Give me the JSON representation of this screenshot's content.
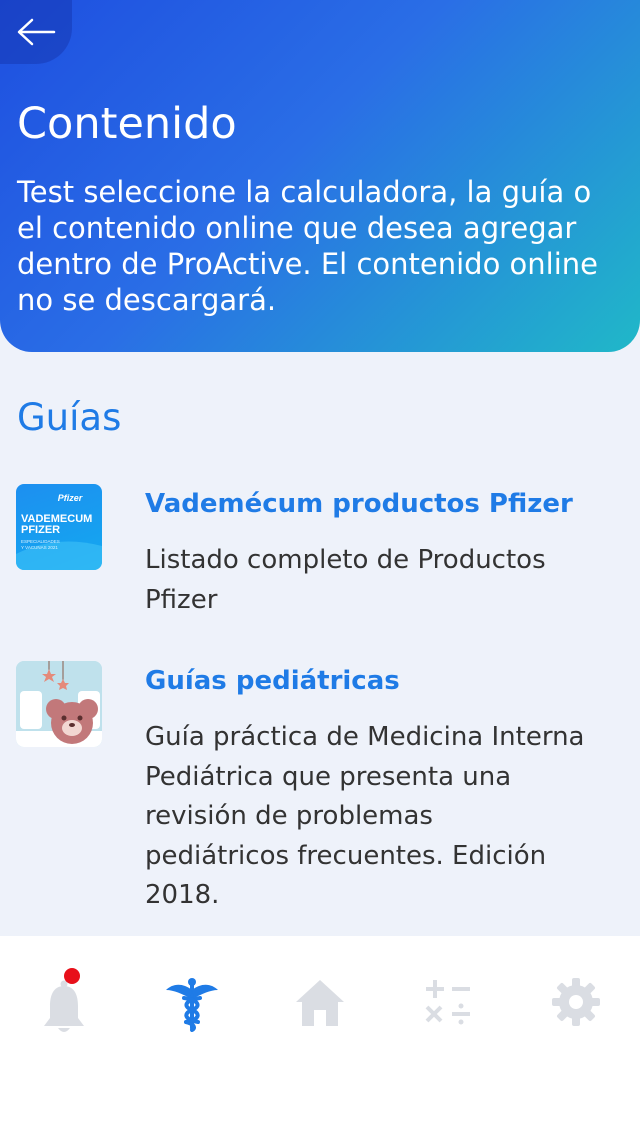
{
  "header": {
    "title": "Contenido",
    "description": "Test seleccione la calculadora, la guía o el contenido online que desea agregar dentro de ProActive. El contenido online no se descargará."
  },
  "section": {
    "title": "Guías"
  },
  "items": [
    {
      "title": "Vademécum productos Pfizer",
      "description": "Listado completo de Productos Pfizer",
      "thumb": {
        "brand": "Pfizer",
        "line1": "VADEMECUM",
        "line2": "PFIZER",
        "line3": "ESPECIALIDADES",
        "line4": "Y VACUNAS 2021"
      }
    },
    {
      "title": "Guías pediátricas",
      "description": "Guía práctica de Medicina Interna Pediátrica que presenta una revisión de problemas pediátricos frecuentes. Edición 2018."
    }
  ],
  "tabbar": {
    "items": [
      {
        "icon": "bell-icon",
        "badge": true
      },
      {
        "icon": "caduceus-icon",
        "active": true
      },
      {
        "icon": "home-icon"
      },
      {
        "icon": "calculator-icon"
      },
      {
        "icon": "gear-icon"
      }
    ],
    "active_color": "#1f7be6",
    "inactive_color": "#dadde3",
    "badge_color": "#e8101a"
  }
}
